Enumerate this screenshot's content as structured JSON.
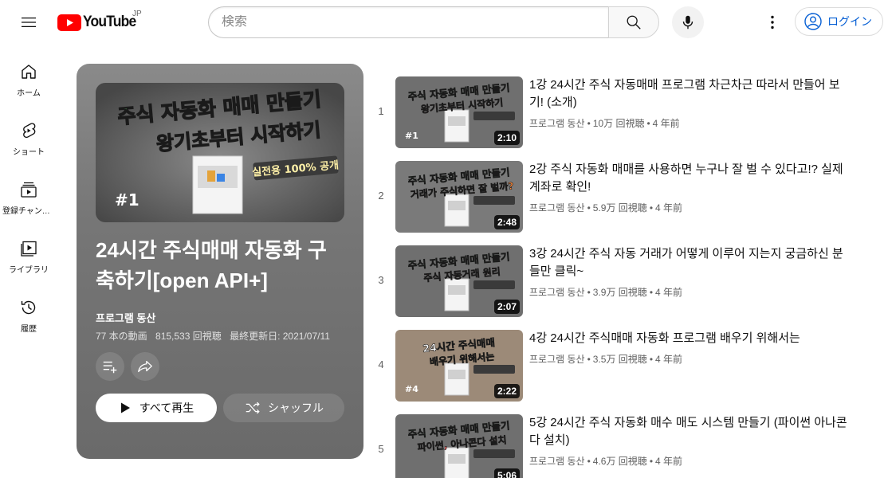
{
  "masthead": {
    "logo_text": "YouTube",
    "country_code": "JP",
    "search_placeholder": "検索",
    "login_label": "ログイン"
  },
  "guide": {
    "items": [
      {
        "label": "ホーム",
        "icon": "home-icon"
      },
      {
        "label": "ショート",
        "icon": "shorts-icon"
      },
      {
        "label": "登録チャンネル",
        "icon": "subscriptions-icon"
      },
      {
        "label": "ライブラリ",
        "icon": "library-icon"
      },
      {
        "label": "履歴",
        "icon": "history-icon"
      }
    ]
  },
  "playlist": {
    "thumb": {
      "line1": "주식 자동화 매매 만들기",
      "line2": "왕기초부터 시작하기",
      "badge": "실전용 100% 공개",
      "episode": "#1"
    },
    "title": "24시간 주식매매 자동화 구축하기[open API+]",
    "owner": "프로그램 동산",
    "video_count": "77 本の動画",
    "views": "815,533 回視聴",
    "updated": "最終更新日: 2021/07/11",
    "play_all_label": "すべて再生",
    "shuffle_label": "シャッフル"
  },
  "videos": [
    {
      "index": "1",
      "title": "1강 24시간 주식 자동매매 프로그램 차근차근 따라서 만들어 보기! (소개)",
      "channel": "프로그램 동산",
      "views": "10万 回視聴",
      "age": "4 年前",
      "duration": "2:10",
      "thumb": {
        "line1": "주식 자동화 매매 만들기",
        "line2": "왕기초부터 시작하기",
        "tag": "#1",
        "bg": "#6f6f6f",
        "c1": "#7df28a",
        "c2": "#ff6a6a"
      }
    },
    {
      "index": "2",
      "title": "2강 주식 자동화 매매를 사용하면 누구나 잘 벌 수 있다고!? 실제 계좌로 확인!",
      "channel": "프로그램 동산",
      "views": "5.9万 回視聴",
      "age": "4 年前",
      "duration": "2:48",
      "thumb": {
        "line1": "주식 자동화 매매 만들기",
        "line2": "거래가 주식하면 잘 벌까?",
        "tag": "",
        "bg": "#7a7a7a",
        "c1": "#7df28a",
        "c2": "#ff8a3a"
      }
    },
    {
      "index": "3",
      "title": "3강 24시간 주식 자동 거래가 어떻게 이루어 지는지 궁금하신 분들만 클릭~",
      "channel": "프로그램 동산",
      "views": "3.9万 回視聴",
      "age": "4 年前",
      "duration": "2:07",
      "thumb": {
        "line1": "주식 자동화 매매 만들기",
        "line2": "주식 자동거래 원리",
        "tag": "",
        "bg": "#6f6f6f",
        "c1": "#7df28a",
        "c2": "#ff6a6a"
      }
    },
    {
      "index": "4",
      "title": "4강 24시간 주식매매 자동화 프로그램 배우기 위해서는",
      "channel": "프로그램 동산",
      "views": "3.5万 回視聴",
      "age": "4 年前",
      "duration": "2:22",
      "thumb": {
        "line1": "24시간 주식매매",
        "line2": "배우기 위해서는",
        "tag": "#4",
        "bg": "#9c8a78",
        "c1": "#ffffff",
        "c2": "#ffe14a"
      }
    },
    {
      "index": "5",
      "title": "5강 24시간 주식 자동화 매수 매도 시스템 만들기 (파이썬 아나콘다 설치)",
      "channel": "프로그램 동산",
      "views": "4.6万 回視聴",
      "age": "4 年前",
      "duration": "5:06",
      "thumb": {
        "line1": "주식 자동화 매매 만들기",
        "line2": "파이썬, 아나콘다 설치",
        "tag": "",
        "bg": "#6f6f6f",
        "c1": "#7df28a",
        "c2": "#ff6a6a"
      }
    }
  ],
  "colors": {
    "youtube_red": "#ff0000",
    "link_blue": "#065fd4",
    "thumb_green": "#7df28a",
    "thumb_red": "#ff6a6a"
  }
}
